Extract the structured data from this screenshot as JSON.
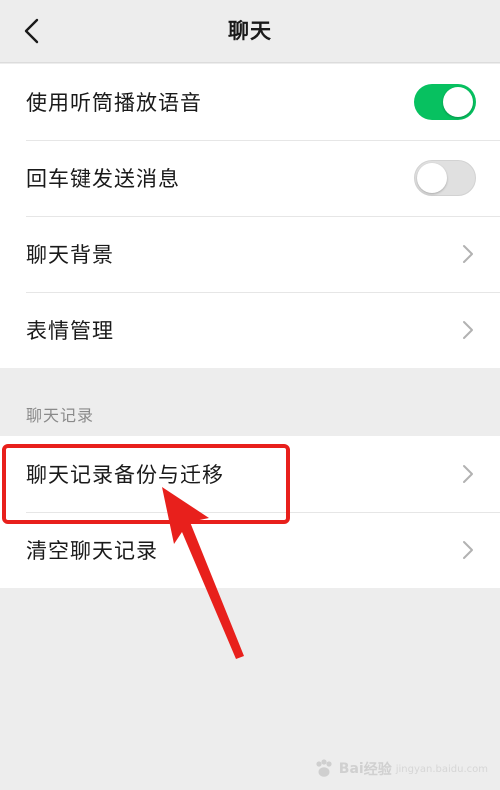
{
  "header": {
    "title": "聊天"
  },
  "settings": {
    "rows": [
      {
        "label": "使用听筒播放语音",
        "type": "toggle",
        "state": "on"
      },
      {
        "label": "回车键发送消息",
        "type": "toggle",
        "state": "off"
      },
      {
        "label": "聊天背景",
        "type": "link"
      },
      {
        "label": "表情管理",
        "type": "link"
      }
    ]
  },
  "chat_history": {
    "section_label": "聊天记录",
    "rows": [
      {
        "label": "聊天记录备份与迁移",
        "type": "link"
      },
      {
        "label": "清空聊天记录",
        "type": "link"
      }
    ]
  },
  "annotation": {
    "highlight_color": "#e8201c"
  },
  "watermark": {
    "brand": "Bai",
    "brand2": "经验",
    "sub": "jingyan.baidu.com"
  },
  "colors": {
    "toggle_on": "#07c160",
    "background": "#ededed"
  }
}
